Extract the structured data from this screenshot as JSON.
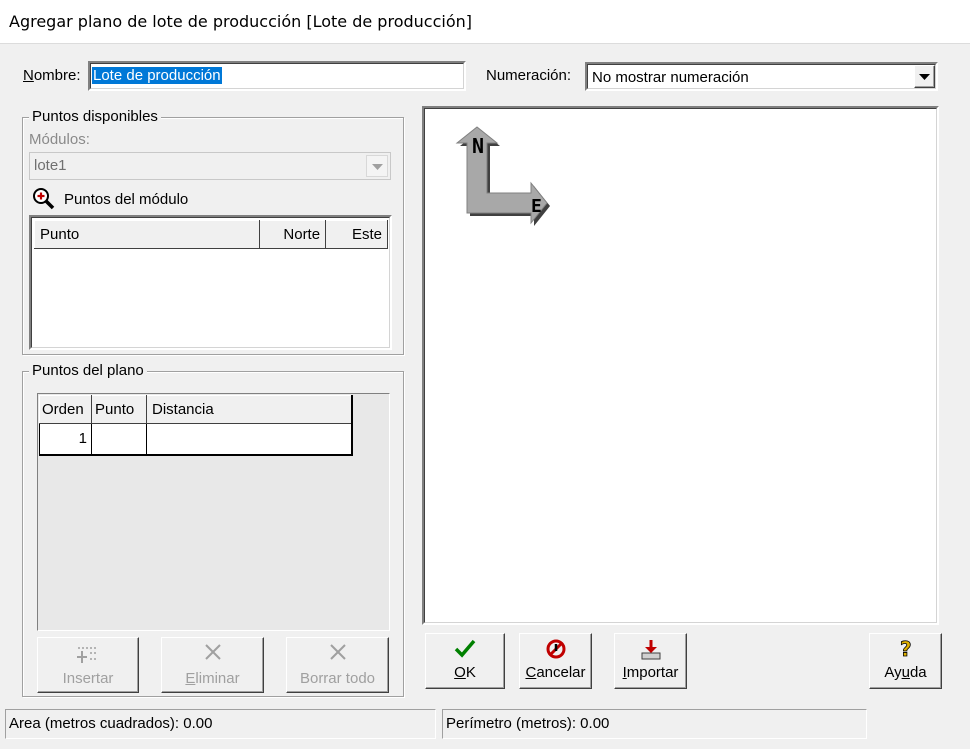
{
  "window": {
    "title": "Agregar plano de lote de producción [Lote de producción]"
  },
  "nombre": {
    "label_underlined": "N",
    "label_rest": "ombre:",
    "value": "Lote de producción"
  },
  "numeracion": {
    "label": "Numeración:",
    "selected": "No mostrar numeración"
  },
  "puntos_disponibles": {
    "legend": "Puntos disponibles",
    "modulos_label": "Módulos:",
    "modulo_selected": "lote1",
    "puntos_modulo_label": "Puntos del módulo",
    "columns": [
      "Punto",
      "Norte",
      "Este"
    ]
  },
  "puntos_plano": {
    "legend": "Puntos del plano",
    "columns": [
      "Orden",
      "Punto",
      "Distancia"
    ],
    "rows": [
      {
        "orden": "1",
        "punto": "",
        "distancia": ""
      }
    ]
  },
  "compass": {
    "north": "N",
    "east": "E"
  },
  "grid_buttons": {
    "insertar": "Insertar",
    "eliminar_underlined": "E",
    "eliminar_rest": "liminar",
    "borrar_todo": "Borrar todo"
  },
  "action_buttons": {
    "ok_underlined": "O",
    "ok_rest": "K",
    "cancelar_underlined": "C",
    "cancelar_rest": "ancelar",
    "importar_underlined": "I",
    "importar_rest": "mportar",
    "ayuda_pre": "Ay",
    "ayuda_underlined": "u",
    "ayuda_post": "da"
  },
  "status": {
    "area": "Area (metros cuadrados): 0.00",
    "perimetro": "Perímetro (metros): 0.00"
  },
  "colors": {
    "selection": "#0078d7",
    "ok_check": "#008000",
    "cancel": "#c00000",
    "import_arrow": "#c00000",
    "help": "#e0b000"
  }
}
